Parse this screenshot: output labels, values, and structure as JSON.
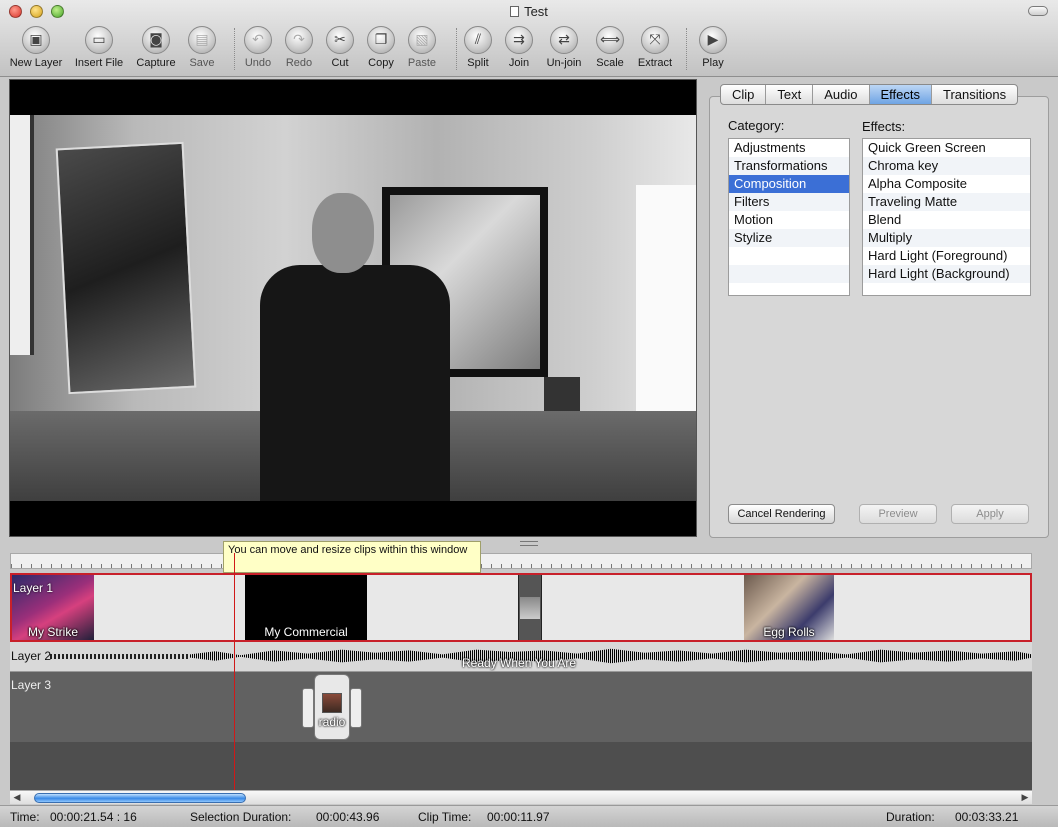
{
  "window": {
    "title": "Test"
  },
  "toolbar": {
    "items": [
      {
        "label": "New Layer",
        "icon": "new-layer-icon"
      },
      {
        "label": "Insert File",
        "icon": "insert-file-icon"
      },
      {
        "label": "Capture",
        "icon": "camera-icon"
      },
      {
        "label": "Save",
        "icon": "save-icon"
      },
      {
        "label": "Undo",
        "icon": "undo-icon"
      },
      {
        "label": "Redo",
        "icon": "redo-icon"
      },
      {
        "label": "Cut",
        "icon": "scissors-icon"
      },
      {
        "label": "Copy",
        "icon": "copy-icon"
      },
      {
        "label": "Paste",
        "icon": "paste-icon"
      },
      {
        "label": "Split",
        "icon": "split-icon"
      },
      {
        "label": "Join",
        "icon": "join-icon"
      },
      {
        "label": "Un-join",
        "icon": "unjoin-icon"
      },
      {
        "label": "Scale",
        "icon": "scale-icon"
      },
      {
        "label": "Extract",
        "icon": "extract-icon"
      },
      {
        "label": "Play",
        "icon": "play-icon"
      }
    ]
  },
  "inspector": {
    "tabs": [
      "Clip",
      "Text",
      "Audio",
      "Effects",
      "Transitions"
    ],
    "active_tab": "Effects",
    "category_label": "Category:",
    "effects_label": "Effects:",
    "categories": [
      "Adjustments",
      "Transformations",
      "Composition",
      "Filters",
      "Motion",
      "Stylize"
    ],
    "selected_category": "Composition",
    "effects": [
      "Quick Green Screen",
      "Chroma key",
      "Alpha Composite",
      "Traveling Matte",
      "Blend",
      "Multiply",
      "Hard Light (Foreground)",
      "Hard Light (Background)"
    ],
    "buttons": {
      "cancel": "Cancel Rendering",
      "preview": "Preview",
      "apply": "Apply"
    }
  },
  "timeline": {
    "tooltip": "You can move and resize clips within this window",
    "layers": [
      {
        "name": "Layer 1",
        "clips": [
          "My Strike",
          "My Commercial",
          "Egg Rolls"
        ]
      },
      {
        "name": "Layer 2",
        "audio_clip": "Ready When You Are"
      },
      {
        "name": "Layer 3",
        "clips": [
          "radio"
        ]
      }
    ]
  },
  "status": {
    "time_label": "Time:",
    "time_value": "00:00:21.54 : 16",
    "selection_label": "Selection Duration:",
    "selection_value": "00:00:43.96",
    "clip_time_label": "Clip Time:",
    "clip_time_value": "00:00:11.97",
    "duration_label": "Duration:",
    "duration_value": "00:03:33.21"
  },
  "colors": {
    "selection_blue": "#3b6fd6",
    "active_tab": "#6fa4e4",
    "playhead": "#d01818",
    "layer_highlight": "#c8202a",
    "tooltip_bg": "#ffffc6"
  }
}
